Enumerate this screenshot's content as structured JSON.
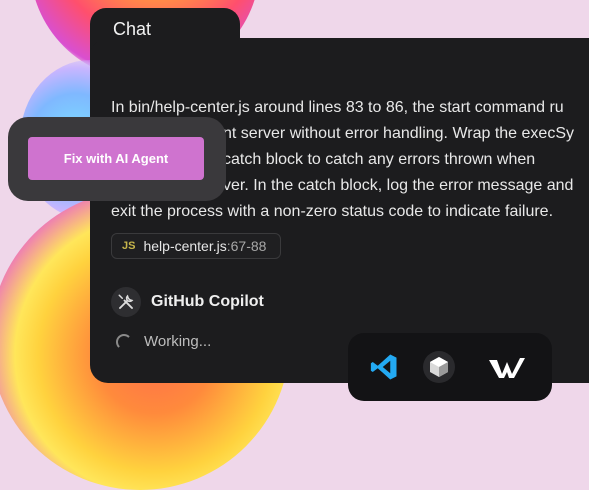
{
  "chat": {
    "title": "Chat",
    "message_lines": [
      "In bin/help-center.js around lines 83 to 86, the start command ru",
      "nt server without error handling. Wrap the execSy",
      "catch block to catch any errors thrown when",
      "ver. In the catch block, log the error message and",
      "exit the process with a non-zero status code to indicate failure."
    ],
    "file_chip": {
      "lang": "JS",
      "file": "help-center.js",
      "lines": ":67-88"
    },
    "assistant": {
      "name": "GitHub Copilot",
      "status": "Working..."
    }
  },
  "fix_card": {
    "button_label": "Fix with AI Agent",
    "button_color": "#cf73cf"
  },
  "dock": {
    "apps": [
      "vscode-icon",
      "cube-app-icon",
      "windsurf-icon"
    ]
  }
}
